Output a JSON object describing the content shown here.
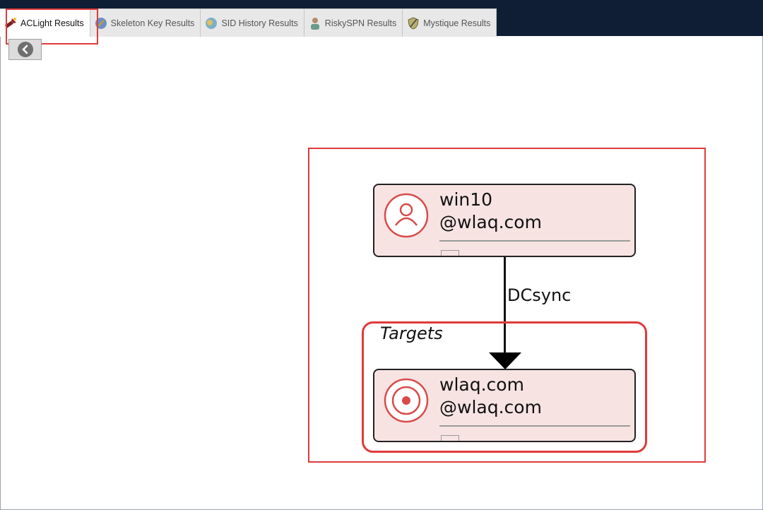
{
  "tabs": [
    {
      "label": "ACLight Results",
      "icon": "flashlight-icon",
      "active": true
    },
    {
      "label": "Skeleton Key Results",
      "icon": "key-globe-icon",
      "active": false
    },
    {
      "label": "SID History Results",
      "icon": "sid-globe-icon",
      "active": false
    },
    {
      "label": "RiskySPN Results",
      "icon": "user-icon",
      "active": false
    },
    {
      "label": "Mystique Results",
      "icon": "shield-icon",
      "active": false
    }
  ],
  "graph": {
    "source": {
      "line1": "win10",
      "line2": "@wlaq.com"
    },
    "edge_label": "DCsync",
    "group_title": "Targets",
    "target": {
      "line1": "wlaq.com",
      "line2": "@wlaq.com"
    }
  },
  "colors": {
    "highlight": "#e03a3a",
    "node_fill": "#f8e3e3",
    "titlebar": "#0f1d35"
  }
}
